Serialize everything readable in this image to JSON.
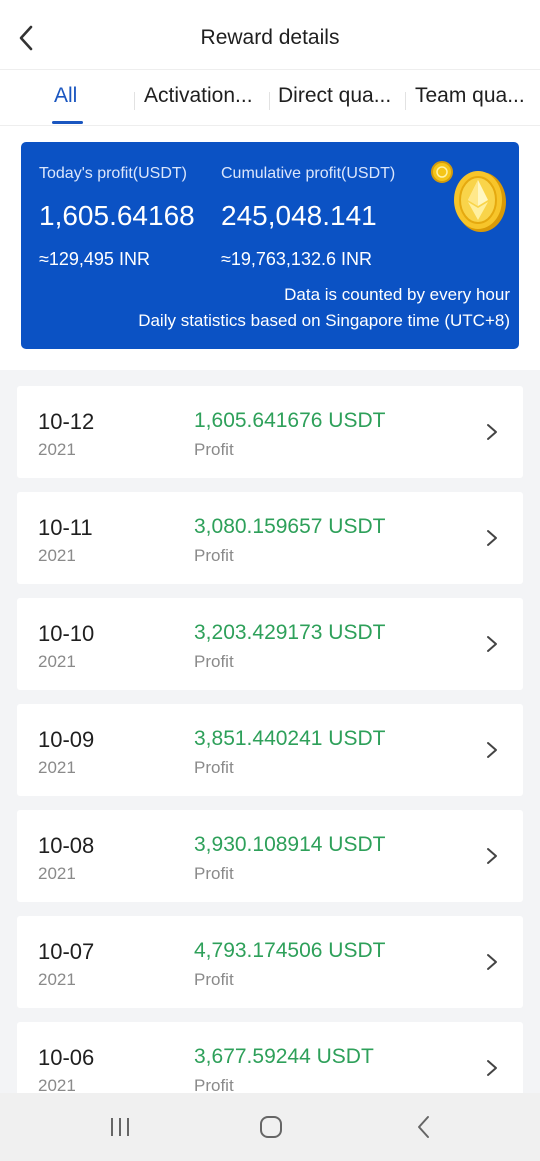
{
  "header": {
    "title": "Reward details",
    "back_icon": "chevron-left-icon"
  },
  "tabs": [
    {
      "label": "All",
      "active": true
    },
    {
      "label": "Activation...",
      "active": false
    },
    {
      "label": "Direct qua...",
      "active": false
    },
    {
      "label": "Team qua...",
      "active": false
    }
  ],
  "summary": {
    "today_label": "Today's profit(USDT)",
    "today_value": "1,605.64168",
    "today_inr": "≈129,495 INR",
    "cumulative_label": "Cumulative profit(USDT)",
    "cumulative_value": "245,048.141",
    "cumulative_inr": "≈19,763,132.6 INR",
    "note_line1": "Data is counted by every hour",
    "note_line2": "Daily statistics based on Singapore time (UTC+8)",
    "coin_icon": "ethereum-coin-icon",
    "card_color": "#0b52c4"
  },
  "records": [
    {
      "date": "10-12",
      "year": "2021",
      "amount": "1,605.641676 USDT",
      "type": "Profit"
    },
    {
      "date": "10-11",
      "year": "2021",
      "amount": "3,080.159657 USDT",
      "type": "Profit"
    },
    {
      "date": "10-10",
      "year": "2021",
      "amount": "3,203.429173 USDT",
      "type": "Profit"
    },
    {
      "date": "10-09",
      "year": "2021",
      "amount": "3,851.440241 USDT",
      "type": "Profit"
    },
    {
      "date": "10-08",
      "year": "2021",
      "amount": "3,930.108914 USDT",
      "type": "Profit"
    },
    {
      "date": "10-07",
      "year": "2021",
      "amount": "4,793.174506 USDT",
      "type": "Profit"
    },
    {
      "date": "10-06",
      "year": "2021",
      "amount": "3,677.59244 USDT",
      "type": "Profit"
    }
  ],
  "colors": {
    "accent": "#1a56c0",
    "profit_green": "#2ea05a"
  },
  "navbar": {
    "recents_icon": "recent-apps-icon",
    "home_icon": "home-icon",
    "back_icon": "back-icon"
  }
}
